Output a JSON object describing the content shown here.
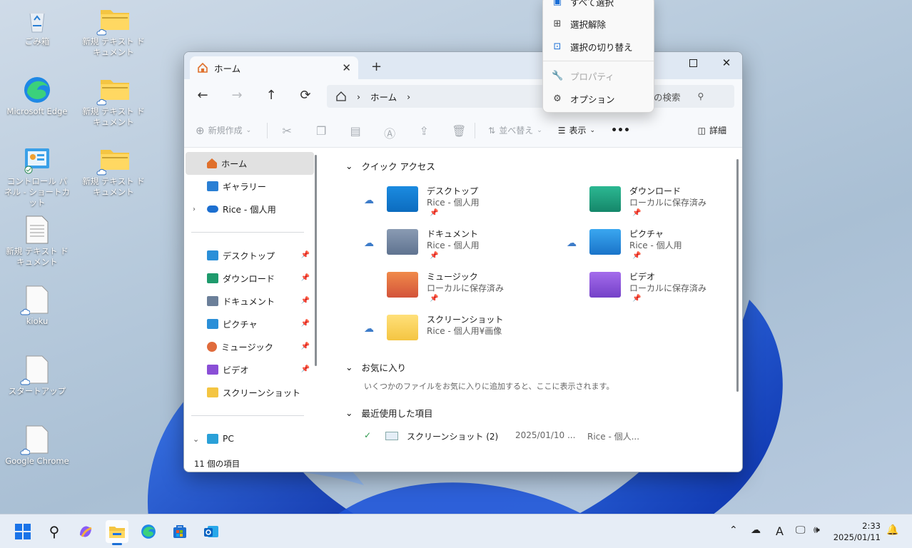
{
  "desktop": {
    "icons": [
      {
        "label": "ごみ箱"
      },
      {
        "label": "新規 テキスト ドキュメント"
      },
      {
        "label": "Microsoft Edge"
      },
      {
        "label": "新規 テキスト ドキュメント"
      },
      {
        "label": "コントロール パネル - ショートカット"
      },
      {
        "label": "新規 テキスト ドキュメント"
      },
      {
        "label": "新規 テキスト ドキュメント"
      },
      {
        "label": "kioku"
      },
      {
        "label": "スタートアップ"
      },
      {
        "label": "Google Chrome"
      }
    ]
  },
  "explorer": {
    "tab_title": "ホーム",
    "address": {
      "crumb": "ホーム"
    },
    "search_placeholder": "の検索",
    "commands": {
      "new": "新規作成",
      "sort": "並べ替え",
      "view": "表示",
      "more": "•••",
      "details": "詳細"
    },
    "sidebar": {
      "top": [
        {
          "label": "ホーム",
          "icon": "home-icon"
        },
        {
          "label": "ギャラリー",
          "icon": "gallery-icon"
        },
        {
          "label": "Rice - 個人用",
          "icon": "onedrive-icon"
        }
      ],
      "pinned": [
        {
          "label": "デスクトップ",
          "color": "#2a8fd8"
        },
        {
          "label": "ダウンロード",
          "color": "#1e9a6c"
        },
        {
          "label": "ドキュメント",
          "color": "#6b7f99"
        },
        {
          "label": "ピクチャ",
          "color": "#2a8fd8"
        },
        {
          "label": "ミュージック",
          "color": "#e06b3c"
        },
        {
          "label": "ビデオ",
          "color": "#8a4fd6"
        },
        {
          "label": "スクリーンショット",
          "color": "#f4c542"
        }
      ],
      "pc": "PC"
    },
    "sections": {
      "quick_access": "クイック アクセス",
      "favorites": "お気に入り",
      "favorites_empty": "いくつかのファイルをお気に入りに追加すると、ここに表示されます。",
      "recent": "最近使用した項目"
    },
    "quick_access_items": [
      {
        "name": "デスクトップ",
        "sub": "Rice - 個人用",
        "cloud": true,
        "pin": true
      },
      {
        "name": "ダウンロード",
        "sub": "ローカルに保存済み",
        "cloud": false,
        "pin": true
      },
      {
        "name": "ドキュメント",
        "sub": "Rice - 個人用",
        "cloud": true,
        "pin": true
      },
      {
        "name": "ピクチャ",
        "sub": "Rice - 個人用",
        "cloud": true,
        "pin": true
      },
      {
        "name": "ミュージック",
        "sub": "ローカルに保存済み",
        "cloud": false,
        "pin": true
      },
      {
        "name": "ビデオ",
        "sub": "ローカルに保存済み",
        "cloud": false,
        "pin": true
      },
      {
        "name": "スクリーンショット",
        "sub": "Rice - 個人用¥画像",
        "cloud": true,
        "pin": false
      }
    ],
    "recent": [
      {
        "name": "スクリーンショット (2)",
        "date": "2025/01/10 ...",
        "location": "Rice - 個人..."
      }
    ],
    "status": "11 個の項目"
  },
  "context_menu": {
    "items": [
      {
        "label": "すべて選択",
        "disabled": false
      },
      {
        "label": "選択解除",
        "disabled": false
      },
      {
        "label": "選択の切り替え",
        "disabled": false
      },
      {
        "label": "プロパティ",
        "disabled": true
      },
      {
        "label": "オプション",
        "disabled": false
      }
    ]
  },
  "taskbar": {
    "clock": {
      "time": "2:33",
      "date": "2025/01/11"
    },
    "ime": "A"
  }
}
